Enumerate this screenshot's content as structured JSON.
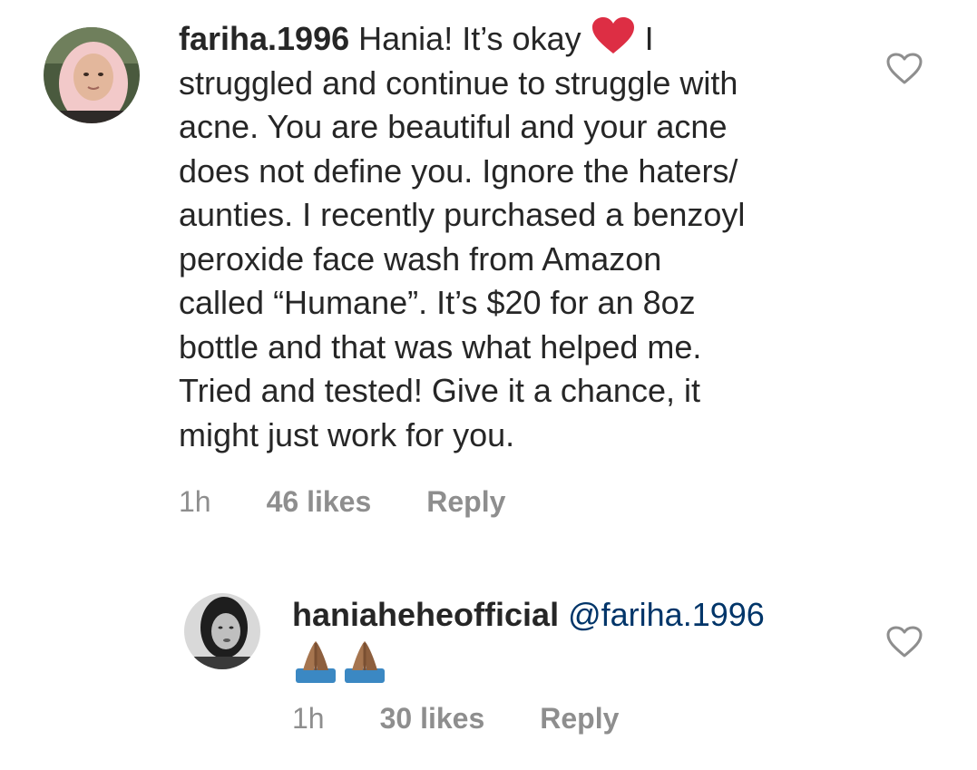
{
  "comments": [
    {
      "username": "fariha.1996",
      "lines": [
        "Hania! It’s okay",
        "struggled and continue to struggle with",
        "acne. You are beautiful and your acne",
        "does not define you. Ignore the haters/",
        "aunties. I recently purchased a benzoyl",
        "peroxide face wash from Amazon",
        "called “Humane”. It’s $20 for an 8oz",
        "bottle and that was what helped me.",
        "Tried and tested! Give it a chance, it",
        "might just work for you."
      ],
      "after_heart": "I",
      "time": "1h",
      "likes": "46 likes",
      "reply": "Reply"
    },
    {
      "username": "haniaheheofficial",
      "mention": "@fariha.1996",
      "time": "1h",
      "likes": "30 likes",
      "reply": "Reply"
    }
  ],
  "icons": {
    "like": "heart-outline-icon",
    "inline_emoji": "red-heart-emoji",
    "reply_emoji": "folded-hands-emoji"
  },
  "colors": {
    "text": "#262626",
    "meta": "#8e8e8e",
    "mention": "#003569",
    "heart_emoji": "#dd2e44"
  }
}
